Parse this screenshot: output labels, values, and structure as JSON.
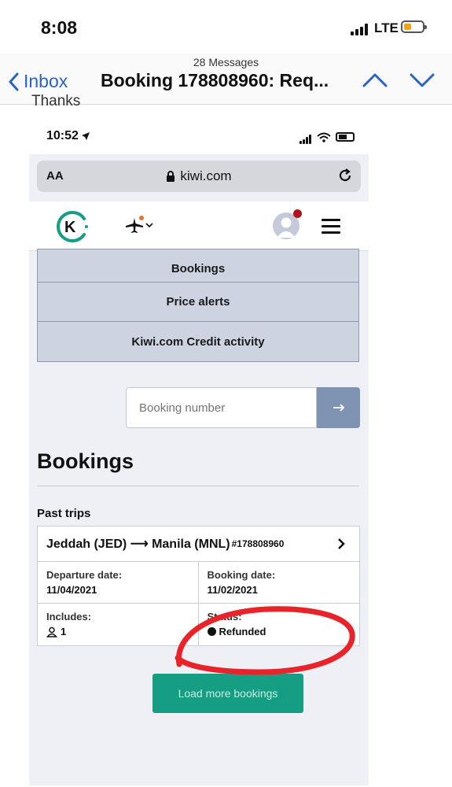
{
  "outer_status": {
    "time": "8:08",
    "network": "LTE"
  },
  "mail": {
    "message_count": "28 Messages",
    "back_label": "Inbox",
    "subject": "Booking 178808960: Req...",
    "partial_text": "Thanks"
  },
  "inner_status": {
    "time": "10:52"
  },
  "browser": {
    "text_size": "AA",
    "domain": "kiwi.com"
  },
  "kiwi_header": {
    "logo_letter": "K"
  },
  "account_menu": [
    "Bookings",
    "Price alerts",
    "Kiwi.com Credit activity"
  ],
  "search": {
    "placeholder": "Booking number"
  },
  "page": {
    "heading": "Bookings",
    "section": "Past trips"
  },
  "trip": {
    "route": "Jeddah (JED) ⟶ Manila (MNL)",
    "booking_ref": "#178808960",
    "departure_label": "Departure date:",
    "departure_value": "11/04/2021",
    "booking_label": "Booking date:",
    "booking_value": "11/02/2021",
    "includes_label": "Includes:",
    "includes_value": "1",
    "status_label": "Status:",
    "status_value": "Refunded"
  },
  "load_more_label": "Load more bookings",
  "colors": {
    "brand_green": "#169e85",
    "annotation_red": "#e8242a",
    "link_blue": "#2a63c6"
  }
}
